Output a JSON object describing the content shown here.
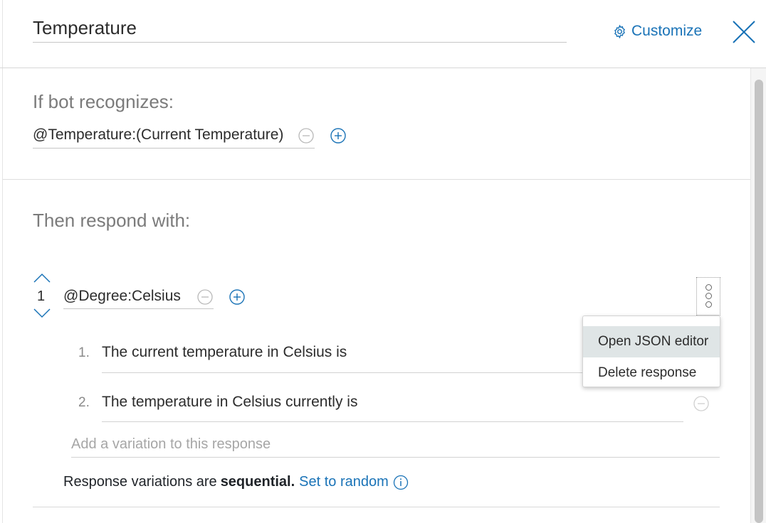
{
  "header": {
    "title_value": "Temperature",
    "customize_label": "Customize",
    "close_icon": "close-x-icon",
    "settings_icon": "gear-icon"
  },
  "condition": {
    "label": "If bot recognizes:",
    "value": "@Temperature:(Current Temperature)"
  },
  "response": {
    "label": "Then respond with:",
    "number": "1",
    "condition_value": "@Degree:Celsius",
    "variations": [
      {
        "number": "1.",
        "text": "The current temperature in Celsius is"
      },
      {
        "number": "2.",
        "text": "The temperature in Celsius currently is"
      }
    ],
    "add_variation_placeholder": "Add a variation to this response",
    "sequence_prefix": "Response variations are",
    "sequence_mode": "sequential.",
    "set_random_link": "Set to random"
  },
  "context_menu": {
    "items": [
      "Open JSON editor",
      "Delete response"
    ],
    "active_item": "Open JSON editor"
  },
  "colors": {
    "accent": "#1a73b7",
    "menu_highlight": "#dfe5e6",
    "muted_text": "#7b7b7b"
  }
}
